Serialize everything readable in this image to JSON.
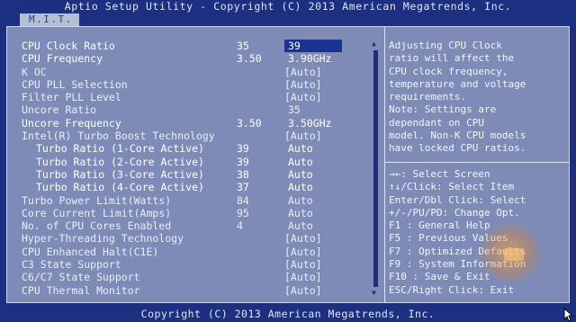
{
  "title": "Aptio Setup Utility - Copyright (C) 2013 American Megatrends, Inc.",
  "tabs": [
    {
      "label": "M.I.T."
    }
  ],
  "settings": [
    {
      "label": "CPU Clock Ratio",
      "current": "35",
      "value": "39",
      "selected": true
    },
    {
      "label": "CPU Frequency",
      "current": "3.50",
      "value": "3.90GHz"
    },
    {
      "label": "K OC",
      "current": "",
      "value": "[Auto]",
      "link": true
    },
    {
      "label": "CPU PLL Selection",
      "current": "",
      "value": "[Auto]",
      "link": true
    },
    {
      "label": "Filter PLL Level",
      "current": "",
      "value": "[Auto]",
      "link": true
    },
    {
      "label": "Uncore Ratio",
      "current": "",
      "value": "35",
      "link": true
    },
    {
      "label": "Uncore Frequency",
      "current": "3.50",
      "value": "3.50GHz"
    },
    {
      "label": "Intel(R) Turbo Boost Technology",
      "current": "",
      "value": "[Auto]",
      "link": true
    },
    {
      "label": "Turbo Ratio (1-Core Active)",
      "current": "39",
      "value": "Auto",
      "indent": true
    },
    {
      "label": "Turbo Ratio (2-Core Active)",
      "current": "39",
      "value": "Auto",
      "indent": true
    },
    {
      "label": "Turbo Ratio (3-Core Active)",
      "current": "38",
      "value": "Auto",
      "indent": true
    },
    {
      "label": "Turbo Ratio (4-Core Active)",
      "current": "37",
      "value": "Auto",
      "indent": true
    },
    {
      "label": "Turbo Power Limit(Watts)",
      "current": "84",
      "value": "Auto",
      "link": true
    },
    {
      "label": "Core Current Limit(Amps)",
      "current": "95",
      "value": "Auto",
      "link": true
    },
    {
      "label": "No. of CPU Cores Enabled",
      "current": "4",
      "value": "Auto",
      "link": true
    },
    {
      "label": "Hyper-Threading Technology",
      "current": "",
      "value": "[Auto]",
      "link": true
    },
    {
      "label": "CPU Enhanced Halt(C1E)",
      "current": "",
      "value": "[Auto]",
      "link": true
    },
    {
      "label": "C3 State Support",
      "current": "",
      "value": "[Auto]",
      "link": true
    },
    {
      "label": "C6/C7 State Support",
      "current": "",
      "value": "[Auto]",
      "link": true
    },
    {
      "label": "CPU Thermal Monitor",
      "current": "",
      "value": "[Auto]",
      "link": true
    }
  ],
  "help": [
    "Adjusting CPU Clock",
    "ratio will affect the",
    "CPU clock frequency,",
    "temperature and voltage",
    "requirements.",
    "Note: Settings are",
    "dependant  on  CPU",
    "model. Non-K CPU models",
    "have locked CPU ratios."
  ],
  "keys": [
    "→←: Select Screen",
    "↑↓/Click: Select Item",
    "Enter/Dbl Click: Select",
    "+/-/PU/PD: Change Opt.",
    "F1  : General Help",
    "F5  : Previous Values",
    "F7  : Optimized Defaults",
    "F9  : System Information",
    "F10 : Save & Exit",
    "ESC/Right Click: Exit"
  ],
  "footer": "Copyright (C) 2013 American Megatrends, Inc.",
  "scroll": {
    "up_icon": "▲",
    "down_icon": "▼"
  },
  "colors": {
    "background": "#1c2f80",
    "panel": "#7d8bb6",
    "selection": "#1a3292",
    "text": "#ffffff"
  }
}
